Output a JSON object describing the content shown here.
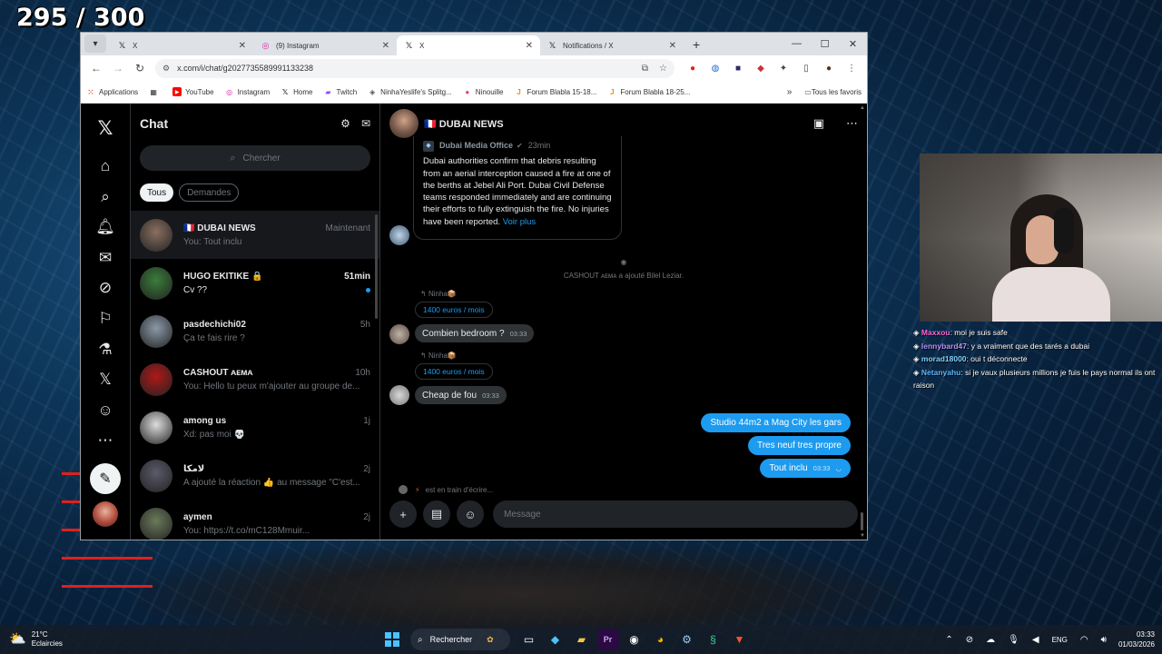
{
  "overlay": {
    "counter": "295 / 300"
  },
  "browser": {
    "tabs": [
      {
        "label": "X",
        "icon": "x-logo-icon",
        "active": false
      },
      {
        "label": "(9) Instagram",
        "icon": "instagram-icon",
        "active": false
      },
      {
        "label": "X",
        "icon": "x-logo-icon",
        "active": true
      },
      {
        "label": "Notifications / X",
        "icon": "x-logo-icon",
        "active": false
      }
    ],
    "url": "x.com/i/chat/g2027735589991133238",
    "bookmarks": [
      {
        "label": "Applications",
        "icon": "apps-grid-icon",
        "color": "#e8453c"
      },
      {
        "label": "",
        "icon": "grid-icon",
        "color": "#333333"
      },
      {
        "label": "YouTube",
        "icon": "youtube-icon",
        "color": "#ff0000"
      },
      {
        "label": "Instagram",
        "icon": "instagram-icon",
        "color": "#d6249f"
      },
      {
        "label": "Home",
        "icon": "x-logo-icon",
        "color": "#000000"
      },
      {
        "label": "Twitch",
        "icon": "twitch-icon",
        "color": "#9146ff"
      },
      {
        "label": "NinhaYeslife's Splitg...",
        "icon": "splitgate-icon",
        "color": "#555555"
      },
      {
        "label": "Ninouille",
        "icon": "ninouille-icon",
        "color": "#e0476b"
      },
      {
        "label": "Forum Blabla 15-18...",
        "icon": "jv-icon",
        "color": "#f08a24"
      },
      {
        "label": "Forum Blabla 18-25...",
        "icon": "jv-icon",
        "color": "#f08a24"
      }
    ],
    "all_bookmarks": "Tous les favoris"
  },
  "chat": {
    "title": "Chat",
    "search_placeholder": "Chercher",
    "filters": [
      "Tous",
      "Demandes"
    ],
    "conversations": [
      {
        "name": "🇫🇷 DUBAI NEWS",
        "time": "Maintenant",
        "preview": "You: Tout inclu",
        "selected": true,
        "unread": false,
        "avatar_color": "#8a6f60"
      },
      {
        "name": "HUGO EKITIKE 🔒",
        "time": "51min",
        "preview": "Cv ??",
        "selected": false,
        "unread": true,
        "avatar_color": "#3a7d3a"
      },
      {
        "name": "pasdechichi02",
        "time": "5h",
        "preview": "Ça te fais rire ?",
        "selected": false,
        "unread": false,
        "avatar_color": "#8a9aa8"
      },
      {
        "name": "CASHOUT ᴀᴇᴍᴀ",
        "time": "10h",
        "preview": "You: Hello tu peux m'ajouter au groupe de...",
        "selected": false,
        "unread": false,
        "avatar_color": "#b01818"
      },
      {
        "name": "among us",
        "time": "1j",
        "preview": "Xd: pas moi 💀",
        "selected": false,
        "unread": false,
        "avatar_color": "#dddddd"
      },
      {
        "name": "لامكا",
        "time": "2j",
        "preview": "A ajouté la réaction 👍 au message \"C'est...",
        "selected": false,
        "unread": false,
        "avatar_color": "#5a5a6a"
      },
      {
        "name": "aymen",
        "time": "2j",
        "preview": "You: https://t.co/mC128Mmuir...",
        "selected": false,
        "unread": false,
        "avatar_color": "#6a7a5a"
      }
    ]
  },
  "conversation": {
    "name": "🇫🇷 DUBAI NEWS",
    "quote": {
      "source": "Dubai Media Office",
      "time": "23min",
      "text": "Dubai authorities confirm that debris resulting from an aerial interception caused a fire at one of the berths at Jebel Ali Port. Dubai Civil Defense teams responded immediately and are continuing their efforts to fully extinguish the fire. No injuries have been reported.",
      "more": "Voir plus"
    },
    "system_message": "CASHOUT ᴀᴇᴍᴀ a ajouté Bilel Leziar.",
    "messages": [
      {
        "reply_to": "Ninha📦",
        "reply_text": "1400 euros / mois",
        "text": "Combien bedroom ?",
        "time": "03:33"
      },
      {
        "reply_to": "Ninha📦",
        "reply_text": "1400 euros / mois",
        "text": "Cheap de fou",
        "time": "03:33"
      }
    ],
    "sent": [
      {
        "text": "Studio 44m2 a Mag City les gars",
        "time": ""
      },
      {
        "text": "Tres neuf tres propre",
        "time": ""
      },
      {
        "text": "Tout inclu",
        "time": "03:33"
      }
    ],
    "typing": "est en train d'écrire...",
    "composer_placeholder": "Message"
  },
  "twitch_chat": [
    {
      "user": "Maxxou",
      "message": "moi je suis safe",
      "color": "#ff6ad5"
    },
    {
      "user": "lennybard47",
      "message": "y a vraiment que des tarés a dubai",
      "color": "#b693ff"
    },
    {
      "user": "morad18000",
      "message": "oui t déconnecte",
      "color": "#7fd3ff"
    },
    {
      "user": "Netanyahu",
      "message": "si je vaux plusieurs millions je fuis le pays normal ils ont raison",
      "color": "#5fb6ff"
    }
  ],
  "taskbar": {
    "weather_temp": "21°C",
    "weather_desc": "Eclaircies",
    "search_label": "Rechercher",
    "lang": "ENG",
    "time": "03:33",
    "date": "01/03/2026"
  }
}
